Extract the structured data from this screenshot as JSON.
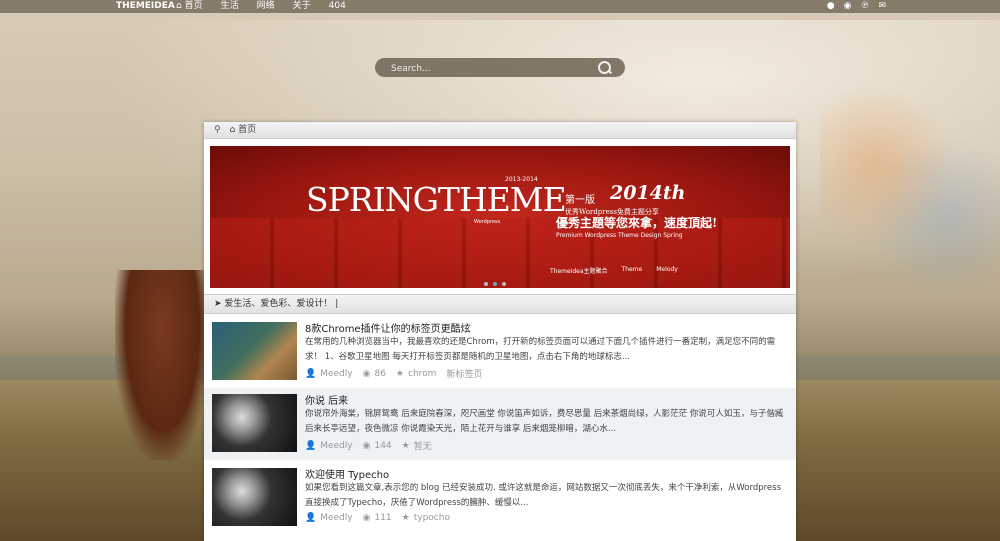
{
  "topbar": {
    "logo": "THEMEIDEA",
    "nav": [
      "首页",
      "生活",
      "网络",
      "关于",
      "404"
    ],
    "social_icons": [
      "github-icon",
      "weibo-icon",
      "pinterest-icon",
      "wechat-icon"
    ]
  },
  "search": {
    "placeholder": "Search..."
  },
  "breadcrumb": {
    "home": "首页"
  },
  "banner": {
    "title": "SPRINGTHEME",
    "years": "2013-2014",
    "edition": "第一版",
    "edition_sub": "优秀Wordpress免费主题分享",
    "year_big": "2014th",
    "slogan": "優秀主題等您來拿，速度頂起!",
    "english": "Premium Wordpress Theme Design Spring",
    "wp": "Wordpress",
    "brand1": "Themeidea主题聚合",
    "brand2": "Theme",
    "brand3": "Melody",
    "slide_count": 3,
    "active_slide": 1
  },
  "notice": "爱生活、爱色彩、爱设计！ |",
  "posts": [
    {
      "title": "8款Chrome插件让你的标签页更酷炫",
      "excerpt": "在常用的几种浏览器当中，我最喜欢的还是Chrom，打开新的标签页面可以通过下面几个插件进行一番定制，满足您不同的需求！ 1、谷歌卫星地图 每天打开标签页都是随机的卫星地图，点击右下角的地球标志...",
      "author": "Meedly",
      "views": "86",
      "tags": "chrom",
      "category": "新标签页"
    },
    {
      "title": "你说 后来",
      "excerpt": "你说帘外海棠，锦屏鸳鸯 后来庭院春深，咫尺画堂 你说笛声如诉，费尽思量 后来茶烟尚绿，人影茫茫 你说可人如玉，与子偕臧 后来长亭远望，夜色微凉 你说霞染天光，陌上花开与谁享 后来烟笼柳暗，湖心水...",
      "author": "Meedly",
      "views": "144",
      "tags": "暂无",
      "category": ""
    },
    {
      "title": "欢迎使用 Typecho",
      "excerpt": "如果您看到这篇文章,表示您的 blog 已经安装成功. 或许这就是命运，网站数据又一次彻底丢失，来个干净利索，从Wordpress直接换成了Typecho，厌倦了Wordpress的臃肿、缓慢以...",
      "author": "Meedly",
      "views": "111",
      "tags": "typocho",
      "category": ""
    }
  ]
}
